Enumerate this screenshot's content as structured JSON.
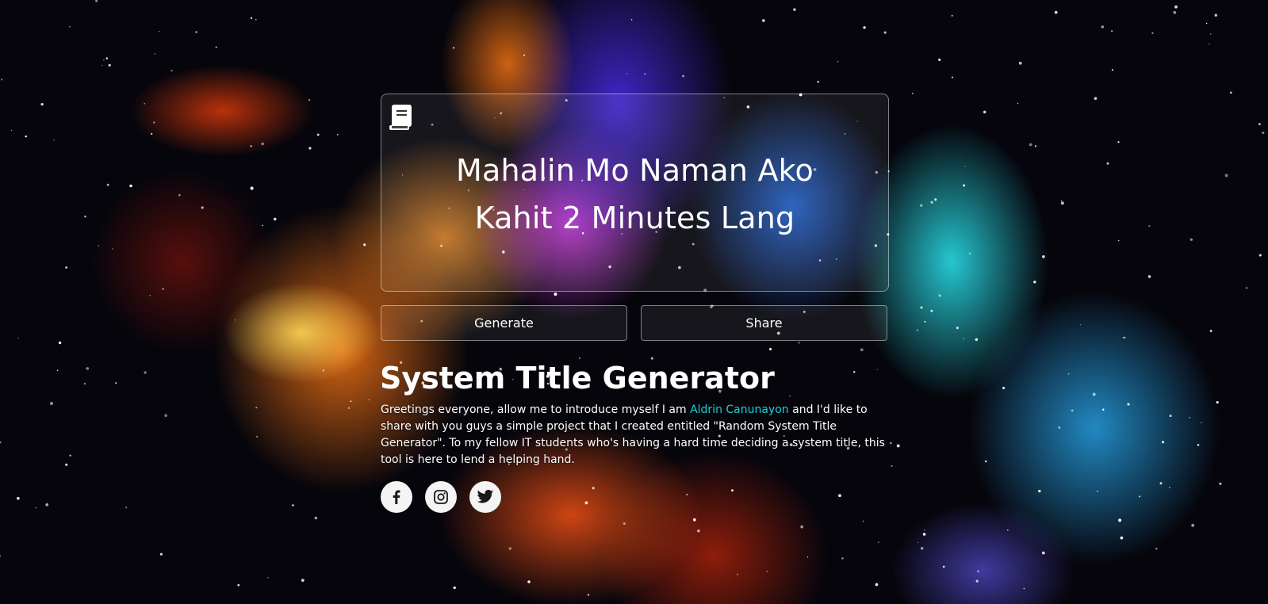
{
  "title_card": {
    "generated_title": "Mahalin Mo Naman Ako Kahit 2 Minutes Lang",
    "icon": "book-icon"
  },
  "actions": {
    "generate_label": "Generate",
    "share_label": "Share"
  },
  "about": {
    "heading": "System Title Generator",
    "intro_before": "Greetings everyone, allow me to introduce myself I am ",
    "author_name": "Aldrin Canunayon",
    "intro_after": " and I'd like to share with you guys a simple project that I created entitled \"Random System Title Generator\". To my fellow IT students who's having a hard time deciding a system title, this tool is here to lend a helping hand."
  },
  "social": [
    {
      "name": "facebook",
      "icon": "facebook-icon"
    },
    {
      "name": "instagram",
      "icon": "instagram-icon"
    },
    {
      "name": "twitter",
      "icon": "twitter-icon"
    }
  ],
  "colors": {
    "link_accent": "#19d3da",
    "text": "#ffffff",
    "social_bg": "#f4f4f4",
    "icon_dark": "#1a1a1a"
  }
}
